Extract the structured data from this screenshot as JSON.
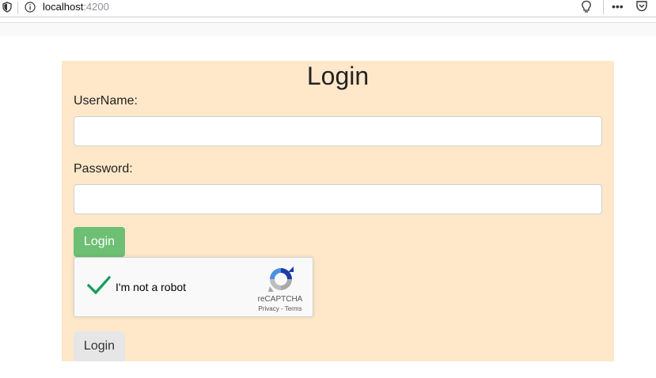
{
  "browser": {
    "url_host": "localhost",
    "url_port": ":4200",
    "menu_glyph": "•••",
    "icons": [
      "shield-icon",
      "info-icon",
      "lightbulb-icon",
      "overflow-menu-icon",
      "pocket-icon"
    ]
  },
  "login": {
    "title": "Login",
    "username_label": "UserName:",
    "username_value": "",
    "password_label": "Password:",
    "password_value": "",
    "submit_label": "Login",
    "secondary_label": "Login"
  },
  "recaptcha": {
    "checkbox_label": "I'm not a robot",
    "brand": "reCAPTCHA",
    "links": "Privacy - Terms",
    "checked": true
  },
  "colors": {
    "card_bg": "#ffe8c9",
    "primary_button": "#6cbf73",
    "secondary_button": "#e6e6e6",
    "check_green": "#0f9d58"
  }
}
